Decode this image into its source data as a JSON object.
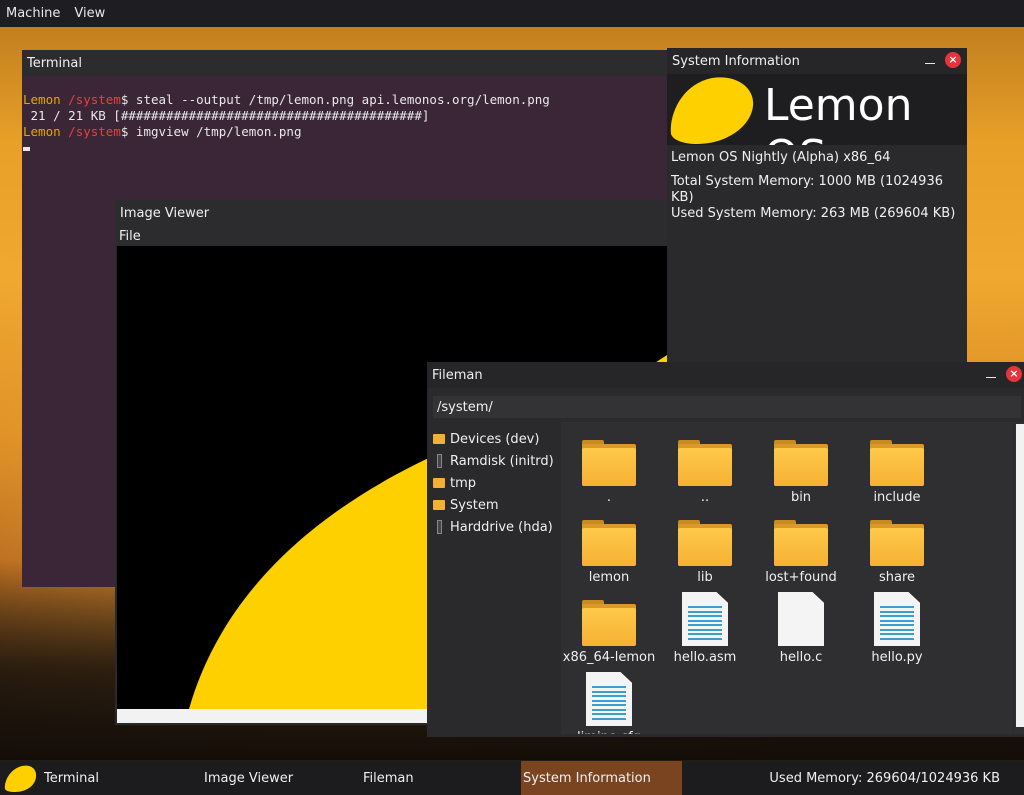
{
  "menubar": {
    "items": [
      "Machine",
      "View"
    ]
  },
  "terminal": {
    "title": "Terminal",
    "lines": [
      {
        "user": "Lemon",
        "path": "/system",
        "prompt": "$",
        "command": " steal --output /tmp/lemon.png api.lemonos.org/lemon.png"
      },
      {
        "output": " 21 / 21 KB [########################################]"
      },
      {
        "user": "Lemon",
        "path": "/system",
        "prompt": "$",
        "command": " imgview /tmp/lemon.png"
      }
    ]
  },
  "imageviewer": {
    "title": "Image Viewer",
    "menu": [
      "File"
    ]
  },
  "sysinfo": {
    "title": "System Information",
    "logo_text": "Lemon OS",
    "version": "Lemon OS Nightly (Alpha) x86_64",
    "total_memory": "Total System Memory: 1000 MB (1024936 KB)",
    "used_memory": "Used System Memory: 263 MB (269604 KB)",
    "close_label": "×"
  },
  "fileman": {
    "title": "Fileman",
    "path": "/system/",
    "close_label": "×",
    "sidebar": [
      {
        "label": "Devices (dev)",
        "icon": "folder-icon"
      },
      {
        "label": "Ramdisk (initrd)",
        "icon": "drive-icon"
      },
      {
        "label": "tmp",
        "icon": "folder-icon"
      },
      {
        "label": "System",
        "icon": "folder-icon"
      },
      {
        "label": "Harddrive (hda)",
        "icon": "drive-icon"
      }
    ],
    "items": [
      {
        "label": ".",
        "type": "folder"
      },
      {
        "label": "..",
        "type": "folder"
      },
      {
        "label": "bin",
        "type": "folder"
      },
      {
        "label": "include",
        "type": "folder"
      },
      {
        "label": "lemon",
        "type": "folder"
      },
      {
        "label": "lib",
        "type": "folder"
      },
      {
        "label": "lost+found",
        "type": "folder"
      },
      {
        "label": "share",
        "type": "folder"
      },
      {
        "label": "x86_64-lemon",
        "type": "folder"
      },
      {
        "label": "hello.asm",
        "type": "text"
      },
      {
        "label": "hello.c",
        "type": "blank"
      },
      {
        "label": "hello.py",
        "type": "text"
      },
      {
        "label": "limine.cfg",
        "type": "text"
      }
    ]
  },
  "taskbar": {
    "items": [
      "Terminal",
      "Image Viewer",
      "Fileman",
      "System Information"
    ],
    "active": "System Information",
    "memory": "Used Memory: 269604/1024936 KB"
  },
  "colors": {
    "lemon_yellow": "#FFD000",
    "close_red": "#E5343A",
    "active_task": "#7A4420",
    "terminal_user": "#E8A600",
    "terminal_path": "#E8413A"
  }
}
